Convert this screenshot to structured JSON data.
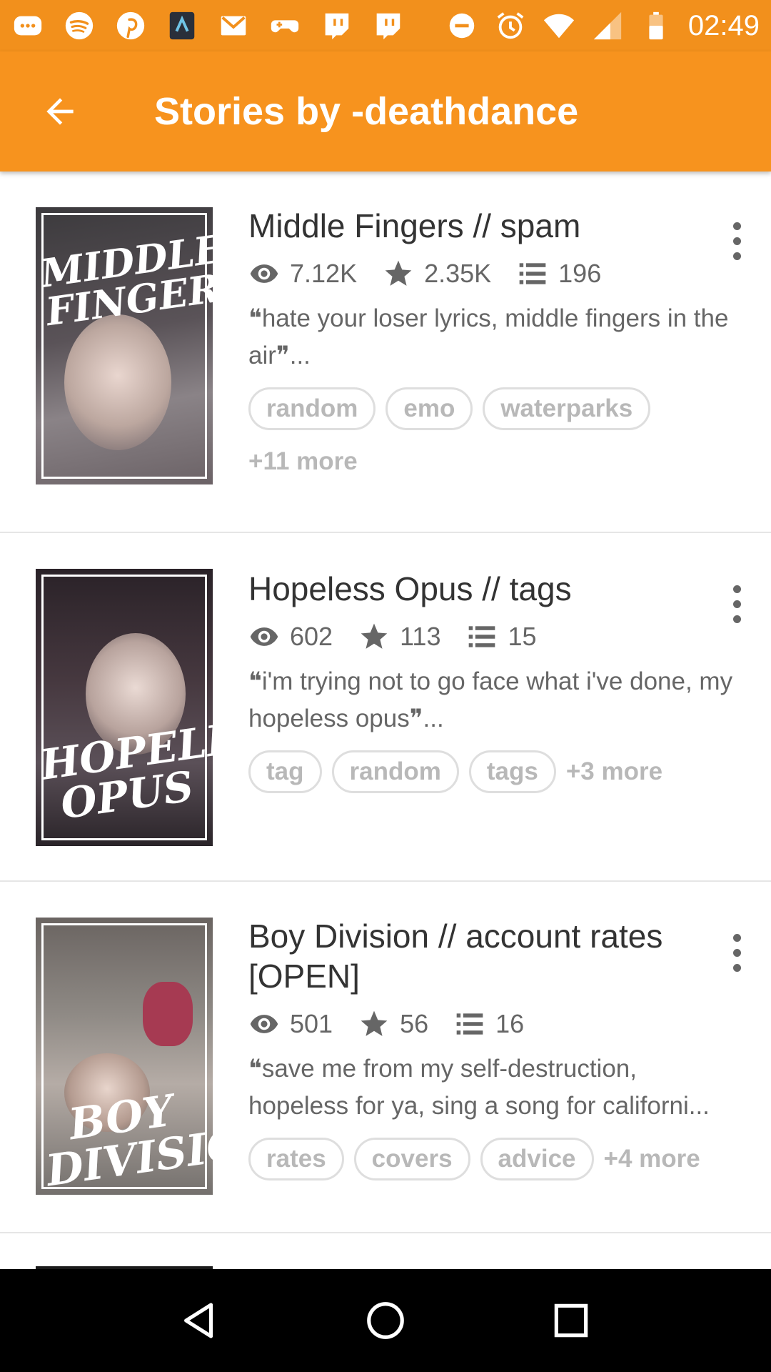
{
  "status_bar": {
    "time": "02:49",
    "icons": [
      "chat-bubble-icon",
      "spotify-icon",
      "pinterest-icon",
      "app-thumbnail-icon",
      "gmail-icon",
      "gamepad-icon",
      "twitch-icon",
      "twitch-icon",
      "do-not-disturb-icon",
      "alarm-icon",
      "wifi-icon",
      "signal-icon",
      "battery-icon"
    ]
  },
  "header": {
    "title": "Stories by -deathdance",
    "back_icon": "back-arrow-icon"
  },
  "colors": {
    "accent": "#f7931e",
    "status_bar": "#f2901c",
    "text_primary": "#333333",
    "text_secondary": "#666666",
    "tag_text": "#b8b8b8"
  },
  "stories": [
    {
      "title": "Middle Fingers // spam",
      "cover_text": "MIDDLE FINGERS",
      "reads": "7.12K",
      "votes": "2.35K",
      "parts": "196",
      "description": "❝hate your loser lyrics, middle fingers in the air❞...",
      "tags": [
        "random",
        "emo",
        "waterparks"
      ],
      "more_tags": "+11 more"
    },
    {
      "title": "Hopeless Opus // tags",
      "cover_text": "HOPELESS OPUS",
      "reads": "602",
      "votes": "113",
      "parts": "15",
      "description": "❝i'm trying not to go face what i've done, my hopeless opus❞...",
      "tags": [
        "tag",
        "random",
        "tags"
      ],
      "more_tags": "+3 more"
    },
    {
      "title": "Boy Division // account rates [OPEN]",
      "cover_text": "BOY DIVISION",
      "reads": "501",
      "votes": "56",
      "parts": "16",
      "description": "❝save me from my self-destruction, hopeless for ya, sing a song for californi...",
      "tags": [
        "rates",
        "covers",
        "advice"
      ],
      "more_tags": "+4 more"
    }
  ],
  "nav_bar": {
    "icons": [
      "nav-back-icon",
      "nav-home-icon",
      "nav-recents-icon"
    ]
  }
}
